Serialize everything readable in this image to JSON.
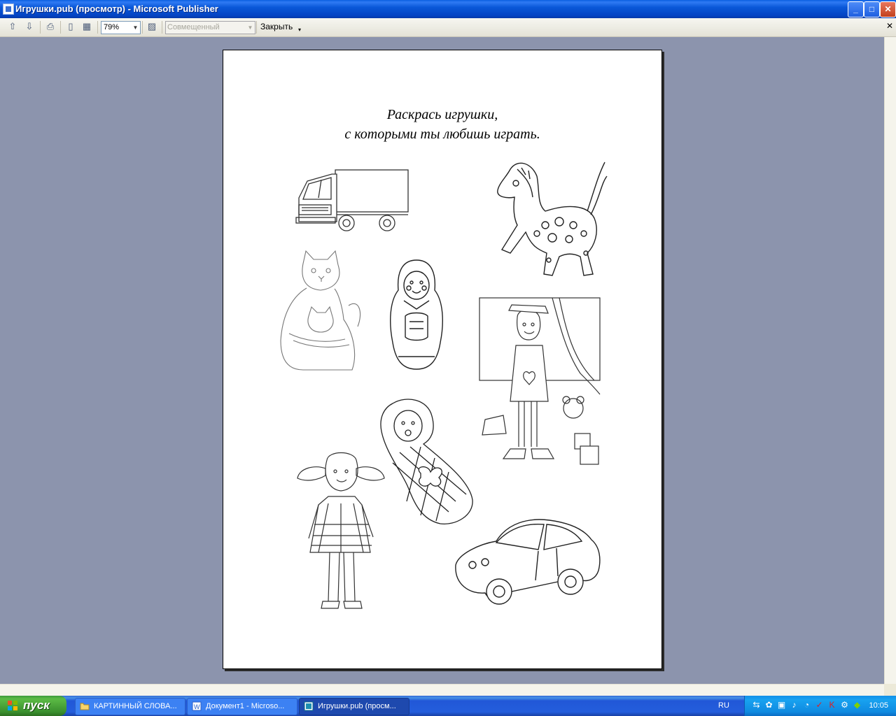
{
  "window": {
    "title": "Игрушки.pub (просмотр)  - Microsoft Publisher",
    "controls": {
      "minimize": "_",
      "maximize": "□",
      "close": "✕"
    }
  },
  "toolbar": {
    "zoom_value": "79%",
    "view_mode": "Совмещенный",
    "close_label": "Закрыть",
    "menu_close": "✕"
  },
  "page": {
    "title_line1": "Раскрась игрушки,",
    "title_line2": "с которыми ты любишь играть.",
    "illustrations": [
      "truck",
      "rocking-horse",
      "cat-with-kitten",
      "matryoshka",
      "girl-with-toys",
      "swaddled-baby-doll",
      "doll-girl",
      "toy-car"
    ]
  },
  "taskbar": {
    "start_label": "пуск",
    "tasks": [
      {
        "label": "КАРТИННЫЙ СЛОВА...",
        "icon": "folder-icon"
      },
      {
        "label": "Документ1 - Microso...",
        "icon": "word-icon"
      },
      {
        "label": "Игрушки.pub (просм...",
        "icon": "publisher-icon"
      }
    ],
    "language": "RU",
    "clock": "10:05"
  },
  "colors": {
    "titlebar": "#0a58d8",
    "workspace": "#8c94ad",
    "taskbar": "#245edc",
    "start_button": "#3a8f2e",
    "tray": "#0f8ae0"
  }
}
